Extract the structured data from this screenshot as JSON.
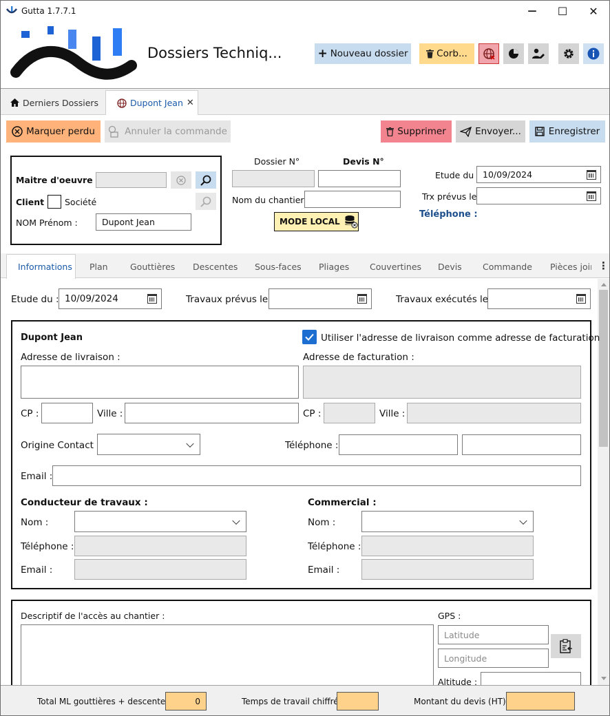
{
  "window": {
    "title": "Gutta 1.7.7.1",
    "minimize": "—",
    "maximize": "☐",
    "close": "✕"
  },
  "header": {
    "title": "Dossiers Techniq...",
    "new_folder": "Nouveau dossier",
    "trash": "Corb...",
    "new_folder_icon": "plus-icon"
  },
  "doc_tabs": [
    {
      "label": "Derniers Dossiers",
      "icon": "home-icon"
    },
    {
      "label": "Dupont Jean",
      "icon": "globe-icon"
    }
  ],
  "actions": {
    "lost": "Marquer perdu",
    "cancel_order": "Annuler la commande",
    "delete": "Supprimer",
    "send": "Envoyer...",
    "save": "Enregistrer"
  },
  "client_box": {
    "maitre_label": "Maitre d'oeuvre :",
    "client_label": "Client :",
    "societe": "Société",
    "nom_prenom_label": "NOM Prénom :",
    "nom_prenom": "Dupont Jean"
  },
  "dossier": {
    "dossier_label": "Dossier N°",
    "devis_label": "Devis N°",
    "chantier_label": "Nom du chantier :",
    "mode_local": "MODE LOCAL"
  },
  "dates_top": {
    "etude_label": "Etude du :",
    "etude": "10/09/2024",
    "trx_label": "Trx prévus le :",
    "telephone_label": "Téléphone :"
  },
  "sub_tabs": [
    "Informations",
    "Plan",
    "Gouttières",
    "Descentes",
    "Sous-faces",
    "Pliages",
    "Couvertines",
    "Devis",
    "Commande",
    "Pièces joint"
  ],
  "info": {
    "etude_label": "Etude du :",
    "etude": "10/09/2024",
    "prevus_label": "Travaux prévus le :",
    "executes_label": "Travaux exécutés le :",
    "client_name": "Dupont Jean",
    "same_address": "Utiliser l'adresse de livraison comme adresse de facturation",
    "livraison_label": "Adresse de livraison :",
    "facturation_label": "Adresse de facturation :",
    "cp_label": "CP :",
    "ville_label": "Ville :",
    "origine_label": "Origine Contact :",
    "telephone_label": "Téléphone :",
    "email_label": "Email :",
    "conducteur_title": "Conducteur de travaux :",
    "commercial_title": "Commercial :",
    "nom_label": "Nom :"
  },
  "acces": {
    "desc_label": "Descriptif de l'accès au chantier :",
    "gps_label": "GPS :",
    "latitude_ph": "Latitude",
    "longitude_ph": "Longitude",
    "altitude_label": "Altitude :"
  },
  "footer": {
    "total_ml_label": "Total ML gouttières + descentes :",
    "total_ml": "0",
    "temps_label": "Temps de travail chiffré :",
    "temps": "",
    "montant_label": "Montant du devis (HT) :",
    "montant": ""
  }
}
